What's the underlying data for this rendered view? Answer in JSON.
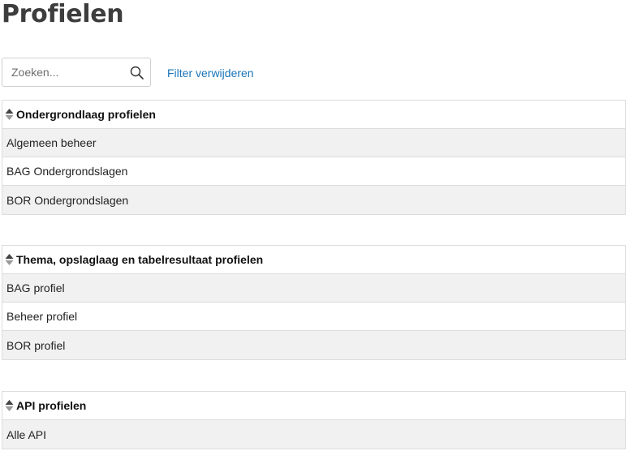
{
  "page": {
    "title": "Profielen"
  },
  "search": {
    "placeholder": "Zoeken...",
    "value": ""
  },
  "filter": {
    "clear_label": "Filter verwijderen"
  },
  "tables": [
    {
      "header": "Ondergrondlaag profielen",
      "rows": [
        "Algemeen beheer",
        "BAG Ondergrondslagen",
        "BOR Ondergrondslagen"
      ]
    },
    {
      "header": "Thema, opslaglaag en tabelresultaat profielen",
      "rows": [
        "BAG profiel",
        "Beheer profiel",
        "BOR profiel"
      ]
    },
    {
      "header": "API profielen",
      "rows": [
        "Alle API"
      ]
    }
  ],
  "colors": {
    "link": "#1a75b8",
    "row_alt": "#f1f1f1",
    "border": "#dcdcdc"
  },
  "icons": {
    "search": "search-icon",
    "sort": "sort-updown-icon"
  }
}
